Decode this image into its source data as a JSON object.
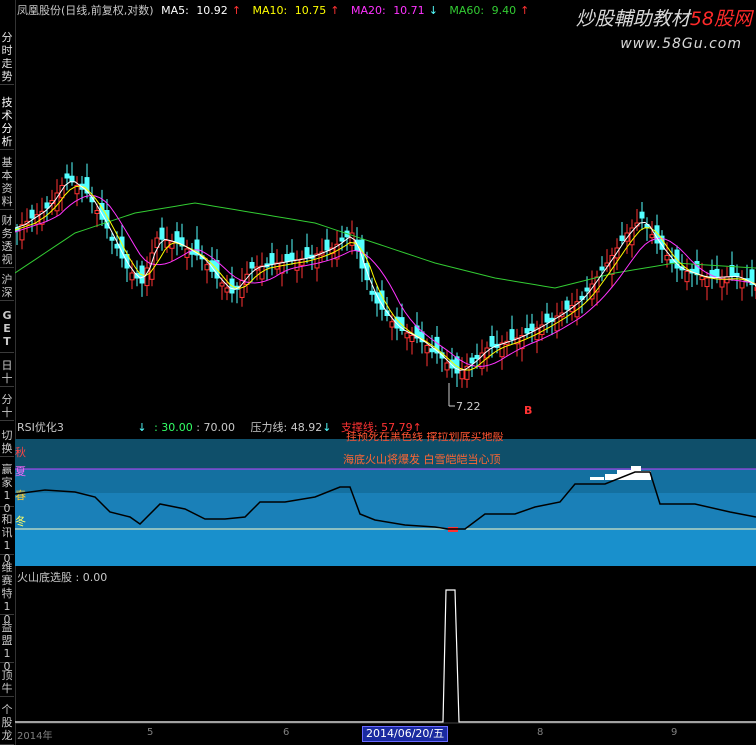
{
  "sidebar": {
    "tabs": [
      {
        "label": "分时走势"
      },
      {
        "label": "技术分析"
      },
      {
        "label": "基本资料"
      },
      {
        "label": "财务透视"
      },
      {
        "label": "沪深"
      },
      {
        "label": "GET"
      },
      {
        "label": "日十"
      },
      {
        "label": "分十"
      },
      {
        "label": "切换"
      },
      {
        "label": "赢家10"
      },
      {
        "label": "和讯10"
      },
      {
        "label": "维赛特10"
      },
      {
        "label": "益盟10"
      },
      {
        "label": "顶牛"
      },
      {
        "label": "个股龙"
      }
    ]
  },
  "header": {
    "stock": "凤凰股份(日线,前复权,对数)",
    "ma5_label": "MA5:",
    "ma5_value": "10.92",
    "ma10_label": "MA10:",
    "ma10_value": "10.75",
    "ma20_label": "MA20:",
    "ma20_value": "10.71",
    "ma60_label": "MA60:",
    "ma60_value": "9.40",
    "up_arrow": "↑",
    "down_arrow": "↓"
  },
  "watermark": {
    "text_a": "炒股輔助教材",
    "text_b": "58股网",
    "url": "www.58Gu.com"
  },
  "price_panel": {
    "low_label": "7.22",
    "marker": "B",
    "colors": {
      "ma5": "#ffffff",
      "ma10": "#ffff00",
      "ma20": "#ff33ff",
      "ma60": "#33cc33",
      "up": "#ff3333",
      "down": "#54ffff"
    }
  },
  "rsi_panel": {
    "title": "RSI优化3",
    "level_low": ": 30.00",
    "level_high": ": 70.00",
    "pressure_label": "压力线:",
    "pressure_value": "48.92",
    "support_label": "支撑线:",
    "support_value": "57.79",
    "arrow_down": "↓",
    "arrow_up": "↑",
    "note_top": "挂预死在黑色线 撑拉划底买地般",
    "note_main": "海底火山将爆发 白雪皑皑当心顶",
    "season_labels": [
      "秋",
      "夏",
      "春",
      "冬"
    ]
  },
  "volcano_panel": {
    "title": "火山底选股",
    "value": ": 0.00"
  },
  "bottom": {
    "year_label": "2014年",
    "ticks": [
      "5",
      "6",
      "8",
      "9"
    ],
    "current_date": "2014/06/20/五"
  }
}
